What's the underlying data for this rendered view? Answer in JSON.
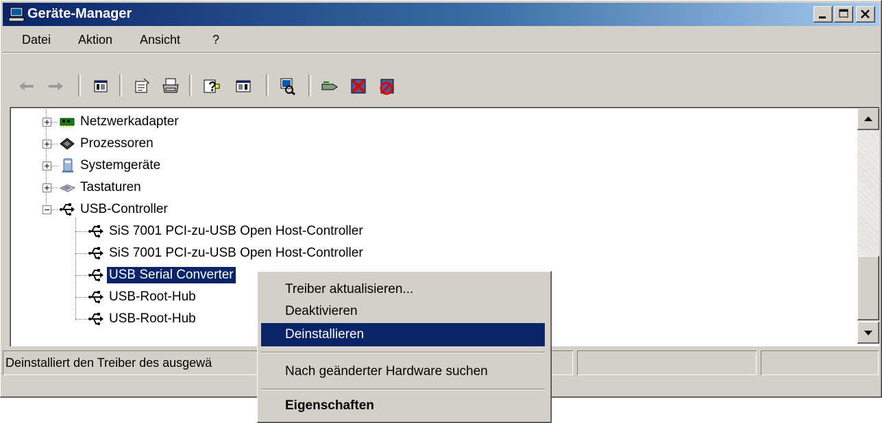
{
  "window": {
    "title": "Geräte-Manager",
    "icons": {
      "app": "computer-icon",
      "minimize": "minimize-icon",
      "maximize": "maximize-icon",
      "close": "close-icon"
    }
  },
  "menu": [
    "Datei",
    "Aktion",
    "Ansicht",
    "?"
  ],
  "toolbar": {
    "icons": [
      "back-arrow-icon",
      "forward-arrow-icon",
      "console-tree-icon",
      "properties-icon",
      "print-icon",
      "help-icon",
      "details-pane-icon",
      "scan-hardware-icon",
      "update-driver-icon",
      "uninstall-icon",
      "disable-icon"
    ]
  },
  "tree": {
    "categories": [
      {
        "label": "Netzwerkadapter",
        "icon": "network-card-icon"
      },
      {
        "label": "Prozessoren",
        "icon": "processor-icon"
      },
      {
        "label": "Systemgeräte",
        "icon": "system-device-icon"
      },
      {
        "label": "Tastaturen",
        "icon": "keyboard-icon"
      },
      {
        "label": "USB-Controller",
        "icon": "usb-icon"
      }
    ],
    "usb_children": [
      {
        "label": "SiS 7001 PCI-zu-USB Open Host-Controller",
        "icon": "usb-icon"
      },
      {
        "label": "SiS 7001 PCI-zu-USB Open Host-Controller",
        "icon": "usb-icon"
      },
      {
        "label": "USB Serial Converter",
        "icon": "usb-icon",
        "selected": true
      },
      {
        "label": "USB-Root-Hub",
        "icon": "usb-icon"
      },
      {
        "label": "USB-Root-Hub",
        "icon": "usb-icon"
      }
    ]
  },
  "statusbar": {
    "text": "Deinstalliert den Treiber des ausgewä"
  },
  "context_menu": {
    "items": [
      "Treiber aktualisieren...",
      "Deaktivieren",
      "Deinstallieren",
      "Nach geänderter Hardware suchen",
      "Eigenschaften"
    ],
    "highlighted": "Deinstallieren",
    "default": "Eigenschaften"
  },
  "colors": {
    "selection": "#0a246a",
    "face": "#d4d0c8",
    "title_start": "#0a246a",
    "title_end": "#a6caf0"
  }
}
